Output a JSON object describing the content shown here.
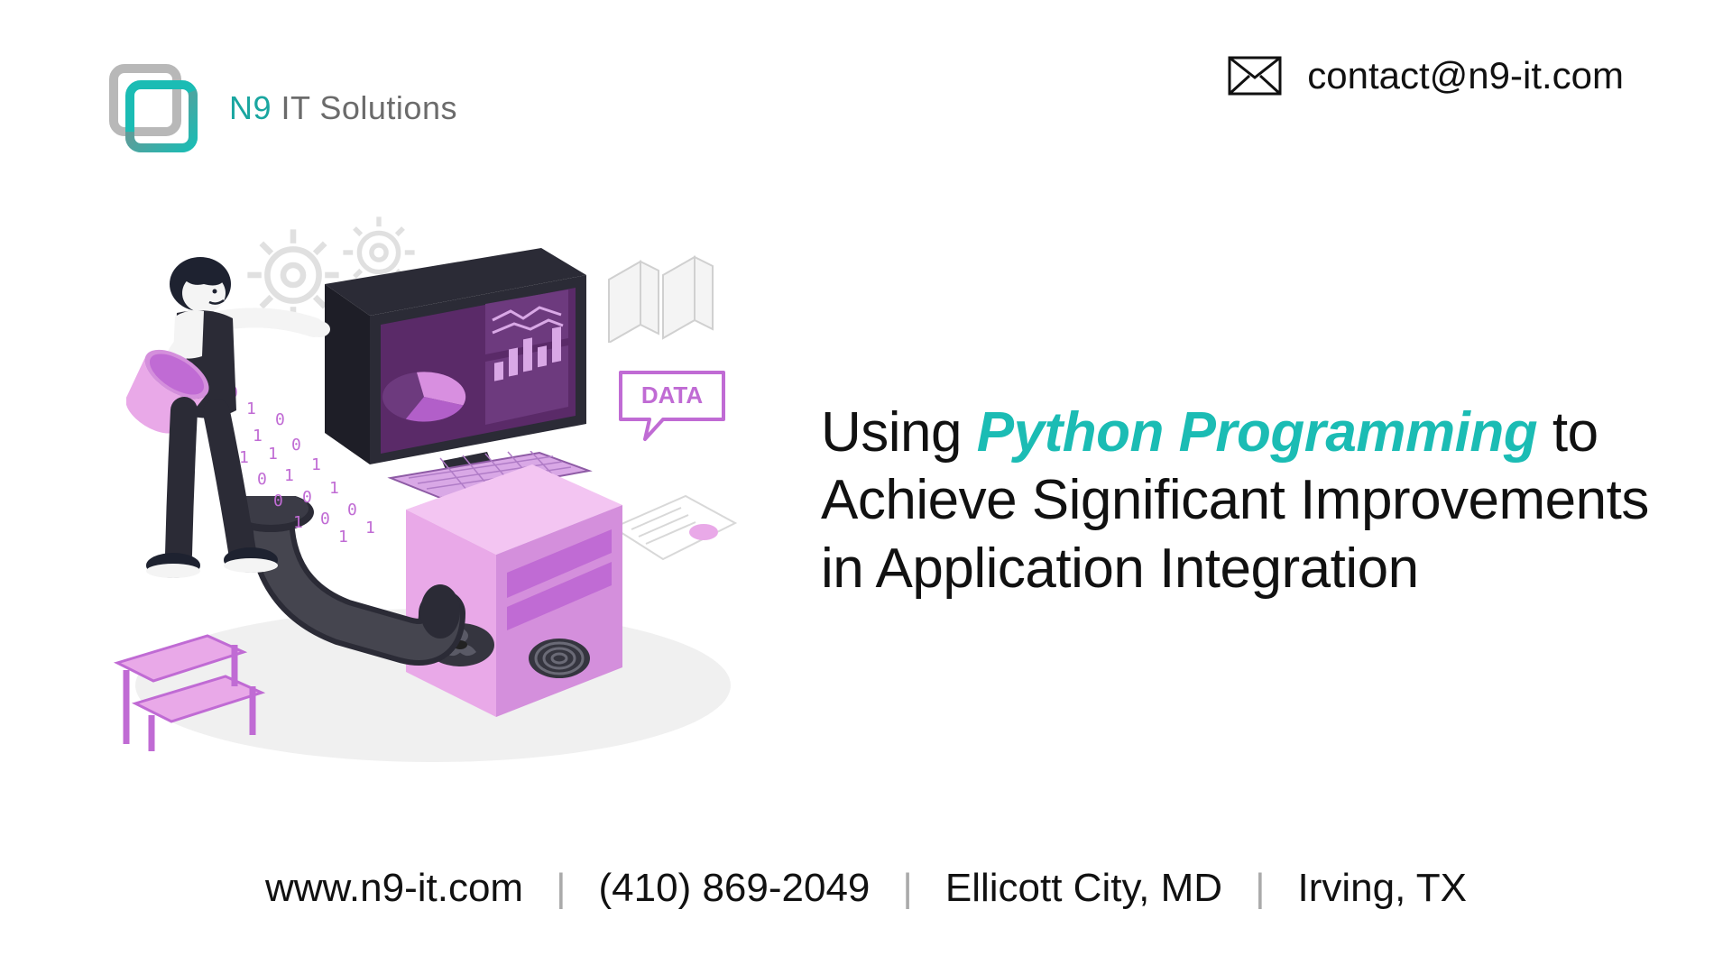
{
  "brand": {
    "name_bold": "N9",
    "name_rest": " IT Solutions"
  },
  "contact": {
    "email": "contact@n9-it.com"
  },
  "headline": {
    "pre": "Using ",
    "accent": "Python Programming",
    "post": " to Achieve Significant Improvements in Application Integration"
  },
  "bubble": {
    "label": "DATA"
  },
  "footer": {
    "website": "www.n9-it.com",
    "phone": "(410) 869-2049",
    "loc1": "Ellicott City, MD",
    "loc2": "Irving, TX",
    "separator": "|"
  },
  "colors": {
    "accent": "#1bbcb4",
    "magenta_light": "#e9a9e8",
    "magenta_dark": "#c06bd4",
    "screen": "#5a2a68",
    "body_dark": "#2b2b36"
  }
}
